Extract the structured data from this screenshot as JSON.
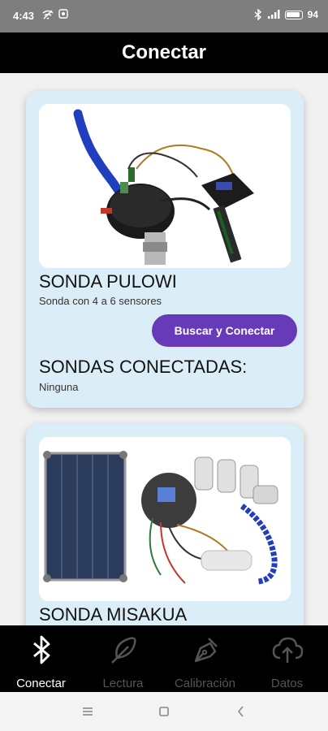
{
  "status_bar": {
    "time": "4:43",
    "battery": "94"
  },
  "app_bar": {
    "title": "Conectar"
  },
  "cards": [
    {
      "title": "SONDA PULOWI",
      "subtitle": "Sonda con 4 a 6 sensores",
      "button_label": "Buscar y Conectar",
      "connected_title": "SONDAS CONECTADAS:",
      "connected_value": "Ninguna"
    },
    {
      "title": "SONDA MISAKUA"
    }
  ],
  "bottom_nav": {
    "items": [
      {
        "label": "Conectar",
        "icon": "bluetooth-icon",
        "active": true
      },
      {
        "label": "Lectura",
        "icon": "feather-icon",
        "active": false
      },
      {
        "label": "Calibración",
        "icon": "pen-nib-icon",
        "active": false
      },
      {
        "label": "Datos",
        "icon": "cloud-upload-icon",
        "active": false
      }
    ]
  },
  "colors": {
    "status_bar": "#7e7e7e",
    "app_bar": "#000000",
    "card_background": "#dbeef7",
    "button": "#673ab7",
    "nav_active": "#ffffff",
    "nav_inactive": "#555555"
  }
}
